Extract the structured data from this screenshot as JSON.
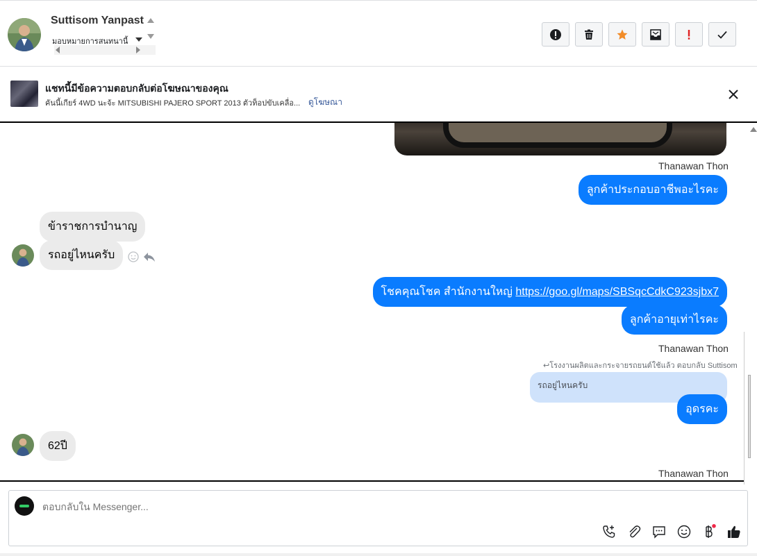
{
  "header": {
    "contact_name": "Suttisom Yanpast",
    "assign_label": "มอบหมายการสนทนานี้",
    "actions": [
      {
        "name": "mark-spam",
        "icon": "exclamation-circle-icon"
      },
      {
        "name": "delete",
        "icon": "trash-icon"
      },
      {
        "name": "star",
        "icon": "star-icon"
      },
      {
        "name": "archive",
        "icon": "archive-icon"
      },
      {
        "name": "priority",
        "icon": "exclamation-icon"
      },
      {
        "name": "done",
        "icon": "check-icon"
      }
    ]
  },
  "ad_banner": {
    "title": "แชทนี้มีข้อความตอบกลับต่อโฆษณาของคุณ",
    "description": "คันนี้เกียร์ 4WD นะจ้ะ MITSUBISHI PAJERO SPORT 2013 ตัวท็อปขับเคลื่อ...",
    "link": "ดูโฆษณา"
  },
  "messages": {
    "sender_1": "Thanawan Thon",
    "out_1": "ลูกค้าประกอบอาชีพอะไรคะ",
    "in_1": "ข้าราชการบำนาญ",
    "in_2": "รถอยู่ไหนครับ",
    "out_2_text": "โชคคุณโชค สำนักงานใหญ่ ",
    "out_2_link": "https://goo.gl/maps/SBSqcCdkC923sjbx7",
    "out_3": "ลูกค้าอายุเท่าไรคะ",
    "sender_2": "Thanawan Thon",
    "replied_note": "โรงงานผลิตและกระจายรถยนต์ใช้แล้ว ตอบกลับ Suttisom",
    "quoted": "รถอยู่ไหนครับ",
    "out_4": "อุดรคะ",
    "in_3": "62ปี",
    "sender_3": "Thanawan Thon"
  },
  "composer": {
    "placeholder": "ตอบกลับใน Messenger..."
  },
  "colors": {
    "accent": "#0a7cff",
    "incoming_bubble": "#ebebeb",
    "star": "#f28c28",
    "priority": "#e02020"
  }
}
